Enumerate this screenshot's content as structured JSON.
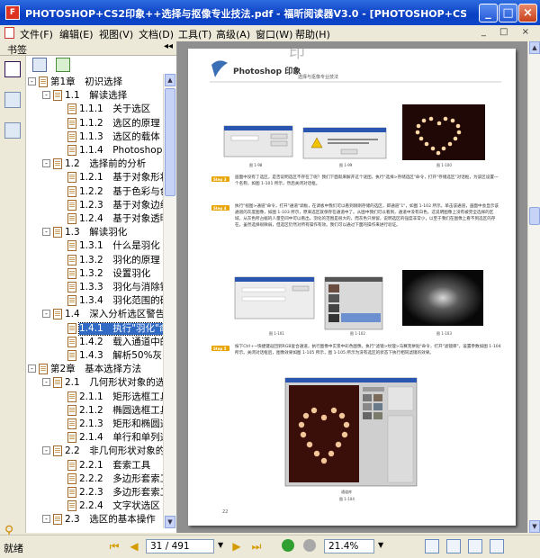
{
  "window": {
    "title": "PHOTOSHOP+CS2印象++选择与抠像专业技法.pdf - 福昕阅读器V3.0 - [PHOTOSHOP+CS2印象++...",
    "app_icon_letter": "F"
  },
  "menu": [
    "文件(F)",
    "编辑(E)",
    "视图(V)",
    "文档(D)",
    "工具(T)",
    "高级(A)",
    "窗口(W)",
    "帮助(H)"
  ],
  "bookmark_panel": {
    "title": "书签",
    "collapse_glyph": "◂◂",
    "items": [
      {
        "label": "第1章　初识选择",
        "level": 0,
        "toggle": "-",
        "selected": false
      },
      {
        "label": "1.1　解读选择",
        "level": 1,
        "toggle": "-",
        "selected": false
      },
      {
        "label": "1.1.1　关于选区",
        "level": 2,
        "toggle": "",
        "selected": false
      },
      {
        "label": "1.1.2　选区的原理",
        "level": 2,
        "toggle": "",
        "selected": false
      },
      {
        "label": "1.1.3　选区的载体",
        "level": 2,
        "toggle": "",
        "selected": false
      },
      {
        "label": "1.1.4　Photoshop的",
        "level": 2,
        "toggle": "",
        "selected": false
      },
      {
        "label": "1.2　选择前的分析",
        "level": 1,
        "toggle": "-",
        "selected": false
      },
      {
        "label": "1.2.1　基于对象形状",
        "level": 2,
        "toggle": "",
        "selected": false
      },
      {
        "label": "1.2.2　基于色彩与色",
        "level": 2,
        "toggle": "",
        "selected": false
      },
      {
        "label": "1.2.3　基于对象边缘",
        "level": 2,
        "toggle": "",
        "selected": false
      },
      {
        "label": "1.2.4　基于对象透明",
        "level": 2,
        "toggle": "",
        "selected": false
      },
      {
        "label": "1.3　解读羽化",
        "level": 1,
        "toggle": "-",
        "selected": false
      },
      {
        "label": "1.3.1　什么是羽化",
        "level": 2,
        "toggle": "",
        "selected": false
      },
      {
        "label": "1.3.2　羽化的原理",
        "level": 2,
        "toggle": "",
        "selected": false
      },
      {
        "label": "1.3.2　设置羽化",
        "level": 2,
        "toggle": "",
        "selected": false
      },
      {
        "label": "1.3.3　羽化与消除锯",
        "level": 2,
        "toggle": "",
        "selected": false
      },
      {
        "label": "1.3.4　羽化范围的确",
        "level": 2,
        "toggle": "",
        "selected": false
      },
      {
        "label": "1.4　深入分析选区警告",
        "level": 1,
        "toggle": "-",
        "selected": false
      },
      {
        "label": "1.4.1　执行\"羽化\"命",
        "level": 2,
        "toggle": "",
        "selected": true
      },
      {
        "label": "1.4.2　载入通道中的",
        "level": 2,
        "toggle": "",
        "selected": false
      },
      {
        "label": "1.4.3　解析50%灰白",
        "level": 2,
        "toggle": "",
        "selected": false
      },
      {
        "label": "第2章　基本选择方法",
        "level": 0,
        "toggle": "-",
        "selected": false
      },
      {
        "label": "2.1　几何形状对象的选择",
        "level": 1,
        "toggle": "-",
        "selected": false
      },
      {
        "label": "2.1.1　矩形选框工具",
        "level": 2,
        "toggle": "",
        "selected": false
      },
      {
        "label": "2.1.2　椭圆选框工具",
        "level": 2,
        "toggle": "",
        "selected": false
      },
      {
        "label": "2.1.3　矩形和椭圆选",
        "level": 2,
        "toggle": "",
        "selected": false
      },
      {
        "label": "2.1.4　单行和单列选",
        "level": 2,
        "toggle": "",
        "selected": false
      },
      {
        "label": "2.2　非几何形状对象的",
        "level": 1,
        "toggle": "-",
        "selected": false
      },
      {
        "label": "2.2.1　套索工具",
        "level": 2,
        "toggle": "",
        "selected": false
      },
      {
        "label": "2.2.2　多边形套索工",
        "level": 2,
        "toggle": "",
        "selected": false
      },
      {
        "label": "2.2.3　多边形套索工",
        "level": 2,
        "toggle": "",
        "selected": false
      },
      {
        "label": "2.2.4　文字状选区",
        "level": 2,
        "toggle": "",
        "selected": false
      },
      {
        "label": "2.3　选区的基本操作",
        "level": 1,
        "toggle": "-",
        "selected": false
      },
      {
        "label": "2.3.1　全选",
        "level": 2,
        "toggle": "",
        "selected": false
      },
      {
        "label": "2.3.2　反选",
        "level": 2,
        "toggle": "",
        "selected": false
      }
    ]
  },
  "page": {
    "header_logo": "Photoshop 印象",
    "header_sub": "选择与抠像专业技法",
    "fig_labels": [
      "图 1-98",
      "图 1-99",
      "图 1-100",
      "图 1-101",
      "图 1-102",
      "图 1-103",
      "通道库",
      "图 1-104"
    ],
    "step3_badge": "Step 3",
    "step3_text": "画面中没有了选区，是否说明选区不存在了呢？我们下面就来解开这个谜团。执行\"选择>存储选区\"命令，打开\"存储选区\"对话框，为该区设置一个名称，如图 1-101 所示，然后关闭对话框。",
    "step4_badge": "Step 4",
    "step4_text": "执行\"视图>通道\"命令，打开\"通道\"调板，在调板中我们可以看到刚刚存储的选区，即通道\"1\"，如图 1-102 所示。单击该通道，画面中会显示该通道的灰度图像，如图 1-103 所示，原来选区就保存在通道中了。从图中我们可以看到，通道中没有白色，这说明图像上没有被完全选择的区域，从灰色所占据的人量空间中可以看出，羽化的范围是很大的，而灰色只保留，说明选区的强度非常小，以至于我们在图像上看不到选区的存在。虽然选择很微弱，但选区仍然对所有操作有效。我们可以通过下面的操作来进行验证。",
    "step5_badge": "Step 5",
    "step5_text": "按下Ctrl+~快捷键返回到RGB复合通道，执行图像中实景中彩色图像。执行\"滤镜>纹理>马赛克拼贴\"命令，打开\"滤镜库\"，设置参数如图 1-104 所示。关闭对话框后，图像效果如图 1-105 所示，图 1-105 所示为没有选区的状态下执行相同滤镜的效果。",
    "page_number": "22"
  },
  "status": {
    "ready": "就绪",
    "page_input": "31 / 491",
    "zoom": "21.4%"
  },
  "colors": {
    "title_blue": "#0a3fc2",
    "selected_bg": "#316ac5",
    "doc_bg": "#8f8f8f"
  }
}
